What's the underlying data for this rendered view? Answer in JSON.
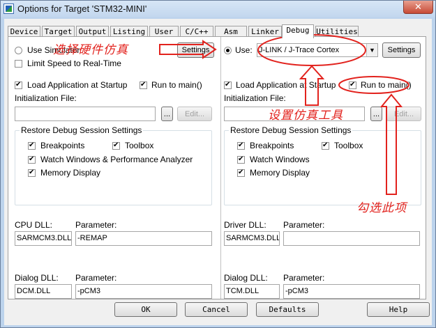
{
  "window": {
    "title": "Options for Target 'STM32-MINI'",
    "close_label": "✕"
  },
  "tabs": [
    {
      "label": "Device"
    },
    {
      "label": "Target"
    },
    {
      "label": "Output"
    },
    {
      "label": "Listing"
    },
    {
      "label": "User"
    },
    {
      "label": "C/C++"
    },
    {
      "label": "Asm"
    },
    {
      "label": "Linker"
    },
    {
      "label": "Debug"
    },
    {
      "label": "Utilities"
    }
  ],
  "left": {
    "use_simulator": "Use Simulator",
    "settings": "Settings",
    "limit_speed": "Limit Speed to Real-Time",
    "load_app": "Load Application at Startup",
    "run_to_main": "Run to main()",
    "init_file": "Initialization File:",
    "browse": "...",
    "edit": "Edit...",
    "restore_title": "Restore Debug Session Settings",
    "breakpoints": "Breakpoints",
    "toolbox": "Toolbox",
    "watch": "Watch Windows & Performance Analyzer",
    "memory": "Memory Display",
    "cpu_dll_label": "CPU DLL:",
    "cpu_dll_value": "SARMCM3.DLL",
    "param_label": "Parameter:",
    "cpu_param_value": "-REMAP",
    "dialog_dll_label": "Dialog DLL:",
    "dialog_dll_value": "DCM.DLL",
    "dialog_param_value": "-pCM3"
  },
  "right": {
    "use": "Use:",
    "driver": "J-LINK / J-Trace Cortex",
    "settings": "Settings",
    "load_app": "Load Application at Startup",
    "run_to_main": "Run to main()",
    "init_file": "Initialization File:",
    "browse": "...",
    "edit": "Edit...",
    "restore_title": "Restore Debug Session Settings",
    "breakpoints": "Breakpoints",
    "toolbox": "Toolbox",
    "watch": "Watch Windows",
    "memory": "Memory Display",
    "driver_dll_label": "Driver DLL:",
    "driver_dll_value": "SARMCM3.DLL",
    "param_label": "Parameter:",
    "driver_param_value": "",
    "dialog_dll_label": "Dialog DLL:",
    "dialog_dll_value": "TCM.DLL",
    "dialog_param_value": "-pCM3"
  },
  "footer": {
    "ok": "OK",
    "cancel": "Cancel",
    "defaults": "Defaults",
    "help": "Help"
  },
  "annotations": {
    "select_hw": "选择硬件仿真",
    "set_tool": "设置仿真工具",
    "check_this": "勾选此项"
  },
  "colors": {
    "annotation": "#e2221d",
    "title_bar": "#c2d6ee"
  }
}
